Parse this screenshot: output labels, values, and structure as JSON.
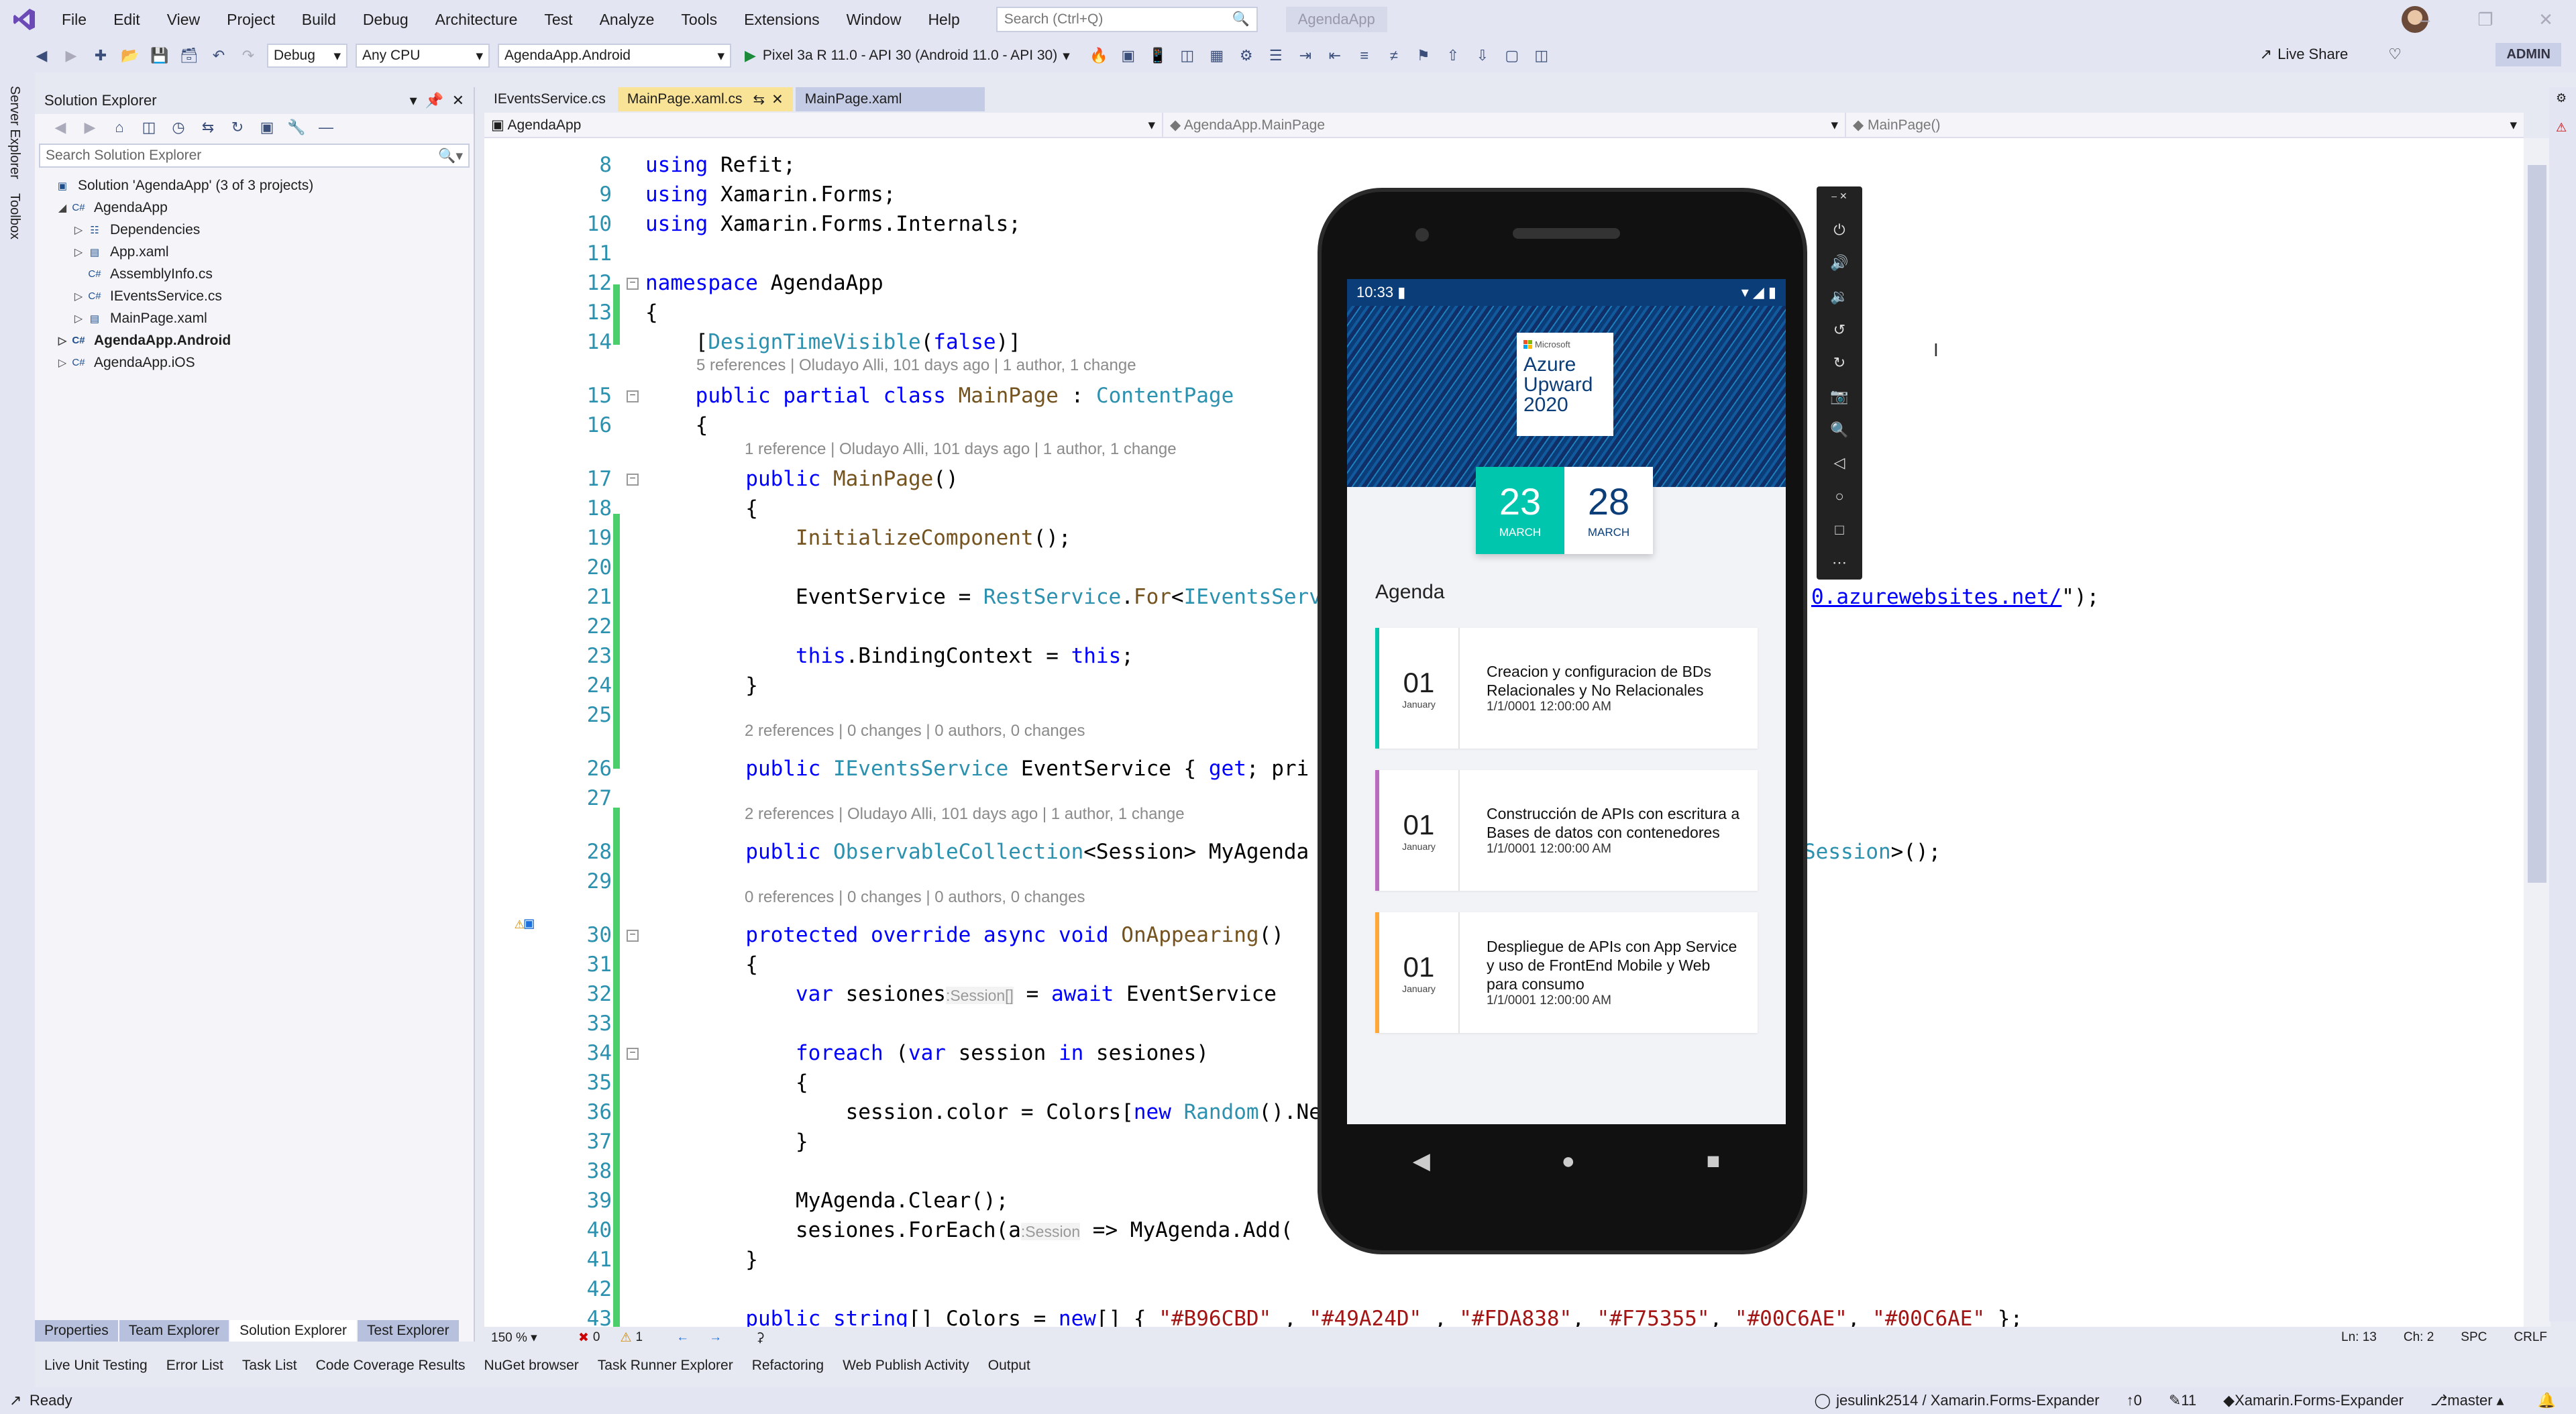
{
  "menu": {
    "items": [
      "File",
      "Edit",
      "View",
      "Project",
      "Build",
      "Debug",
      "Architecture",
      "Test",
      "Analyze",
      "Tools",
      "Extensions",
      "Window",
      "Help"
    ],
    "search_placeholder": "Search (Ctrl+Q)",
    "app_title": "AgendaApp"
  },
  "toolbar": {
    "config": "Debug",
    "platform": "Any CPU",
    "startup_project": "AgendaApp.Android",
    "run_target": "Pixel 3a R 11.0 - API 30 (Android 11.0 - API 30)",
    "live_share": "Live Share",
    "admin": "ADMIN"
  },
  "left_strip": {
    "server_explorer": "Server Explorer",
    "toolbox": "Toolbox"
  },
  "solution_explorer": {
    "title": "Solution Explorer",
    "search_placeholder": "Search Solution Explorer",
    "nodes": [
      {
        "label": "Solution 'AgendaApp' (3 of 3 projects)"
      },
      {
        "label": "AgendaApp"
      },
      {
        "label": "Dependencies"
      },
      {
        "label": "App.xaml"
      },
      {
        "label": "AssemblyInfo.cs"
      },
      {
        "label": "IEventsService.cs"
      },
      {
        "label": "MainPage.xaml"
      },
      {
        "label": "AgendaApp.Android"
      },
      {
        "label": "AgendaApp.iOS"
      }
    ],
    "bottom_tabs": [
      "Properties",
      "Team Explorer",
      "Solution Explorer",
      "Test Explorer"
    ]
  },
  "tabs": [
    {
      "label": "IEventsService.cs"
    },
    {
      "label": "MainPage.xaml.cs"
    },
    {
      "label": "MainPage.xaml"
    }
  ],
  "navbar": {
    "project": "AgendaApp",
    "type": "AgendaApp.MainPage",
    "member": "MainPage()"
  },
  "code": {
    "lines": [
      {
        "n": "8",
        "t": "using Refit;"
      },
      {
        "n": "9",
        "t": "using Xamarin.Forms;"
      },
      {
        "n": "10",
        "t": "using Xamarin.Forms.Internals;"
      },
      {
        "n": "11",
        "t": ""
      },
      {
        "n": "12",
        "t": "namespace AgendaApp"
      },
      {
        "n": "13",
        "t": "{"
      },
      {
        "n": "14",
        "t": "    [DesignTimeVisible(false)]"
      },
      {
        "n": "15",
        "t": "    public partial class MainPage : ContentPage"
      },
      {
        "n": "16",
        "t": "    {"
      },
      {
        "n": "17",
        "t": "        public MainPage()"
      },
      {
        "n": "18",
        "t": "        {"
      },
      {
        "n": "19",
        "t": "            InitializeComponent();"
      },
      {
        "n": "20",
        "t": ""
      },
      {
        "n": "21",
        "t": "            EventService = RestService.For<IEventsServ"
      },
      {
        "n": "22",
        "t": ""
      },
      {
        "n": "23",
        "t": "            this.BindingContext = this;"
      },
      {
        "n": "24",
        "t": "        }"
      },
      {
        "n": "25",
        "t": ""
      },
      {
        "n": "26",
        "t": "        public IEventsService EventService { get; pri"
      },
      {
        "n": "27",
        "t": ""
      },
      {
        "n": "28",
        "t": "        public ObservableCollection<Session> MyAgenda"
      },
      {
        "n": "29",
        "t": ""
      },
      {
        "n": "30",
        "t": "        protected override async void OnAppearing()"
      },
      {
        "n": "31",
        "t": "        {"
      },
      {
        "n": "32",
        "t": "            var sesiones"
      },
      {
        "n": "33",
        "t": ""
      },
      {
        "n": "34",
        "t": "            foreach (var session in sesiones)"
      },
      {
        "n": "35",
        "t": "            {"
      },
      {
        "n": "36",
        "t": "                session.color = Colors[new Random().Ne"
      },
      {
        "n": "37",
        "t": "            }"
      },
      {
        "n": "38",
        "t": ""
      },
      {
        "n": "39",
        "t": "            MyAgenda.Clear();"
      },
      {
        "n": "40",
        "t": "            sesiones.ForEach(a"
      },
      {
        "n": "41",
        "t": "        }"
      },
      {
        "n": "42",
        "t": ""
      },
      {
        "n": "43",
        "t": "        public string[] Colors = new[] { \"#B96CBD\" , \"#49A24D\" , \"#FDA838\", \"#F75355\", \"#00C6AE\", \"#00C6AE\" };"
      }
    ],
    "line32_rest": " = await EventService",
    "line32_hint": ":Session[]",
    "line40_hint": ":Session",
    "line40_rest": " => MyAgenda.Add(",
    "line21_tail": "0.azurewebsites.net/\");",
    "line28_tail": "Session>();",
    "lens": [
      "5 references | Oludayo Alli, 101 days ago | 1 author, 1 change",
      "1 reference | Oludayo Alli, 101 days ago | 1 author, 1 change",
      "2 references | 0 changes | 0 authors, 0 changes",
      "2 references | Oludayo Alli, 101 days ago | 1 author, 1 change",
      "0 references | 0 changes | 0 authors, 0 changes"
    ]
  },
  "editor_status": {
    "zoom": "150 %",
    "errors": "0",
    "warnings": "1",
    "position": "Ln: 13",
    "col": "Ch: 2",
    "spc": "SPC",
    "crlf": "CRLF"
  },
  "bottom_tabs": [
    "Live Unit Testing",
    "Error List",
    "Task List",
    "Code Coverage Results",
    "NuGet browser",
    "Task Runner Explorer",
    "Refactoring",
    "Web Publish Activity",
    "Output"
  ],
  "statusbar": {
    "ready": "Ready",
    "repo": "jesulink2514 / Xamarin.Forms-Expander",
    "up": "0",
    "pencil": "11",
    "branch_repo": "Xamarin.Forms-Expander",
    "branch": "master"
  },
  "phone": {
    "time": "10:33",
    "badge_brand": "Microsoft",
    "badge_title": "Azure Upward 2020",
    "dates": [
      {
        "day": "23",
        "month": "MARCH"
      },
      {
        "day": "28",
        "month": "MARCH"
      }
    ],
    "agenda_title": "Agenda",
    "sessions": [
      {
        "day": "01",
        "month": "January",
        "title": "Creacion y configuracion de BDs Relacionales y No Relacionales",
        "datetime": "1/1/0001 12:00:00 AM",
        "color": "#00C6AE"
      },
      {
        "day": "01",
        "month": "January",
        "title": "Construcción de APIs con escritura a Bases de datos con contenedores",
        "datetime": "1/1/0001 12:00:00 AM",
        "color": "#B96CBD"
      },
      {
        "day": "01",
        "month": "January",
        "title": "Despliegue de APIs con App Service y uso de FrontEnd Mobile y Web para consumo",
        "datetime": "1/1/0001 12:00:00 AM",
        "color": "#FDA838"
      }
    ]
  },
  "emulator_tools": [
    "power-icon",
    "volume-up-icon",
    "volume-down-icon",
    "rotate-left-icon",
    "rotate-right-icon",
    "camera-icon",
    "zoom-icon",
    "back-icon",
    "home-icon",
    "overview-icon",
    "more-icon"
  ]
}
